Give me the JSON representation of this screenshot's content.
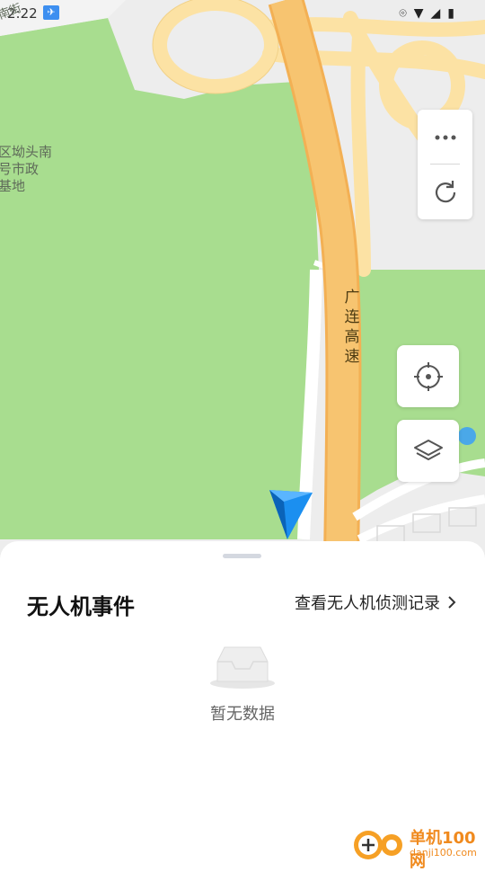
{
  "status_bar": {
    "time": "2:22",
    "icons": [
      "drone-icon",
      "location-icon",
      "wifi-icon",
      "signal-icon",
      "battery-icon"
    ]
  },
  "map": {
    "labels": {
      "top_street": "南街",
      "base_name": "区坳头南\n号市政\n基地",
      "highway": "广\n连\n高\n速"
    },
    "colors": {
      "park": "#a8dd8f",
      "road_major": "#f7c470",
      "road_major_edge": "#f3b054",
      "ramp": "#fce2a4",
      "ground": "#ededed"
    }
  },
  "controls": {
    "more_icon": "more-dots-icon",
    "refresh_icon": "refresh-icon",
    "locate_icon": "locate-target-icon",
    "layers_icon": "layers-icon"
  },
  "sheet": {
    "title": "无人机事件",
    "link_label": "查看无人机侦测记录",
    "empty_text": "暂无数据"
  },
  "watermark": {
    "brand": "单机100网",
    "site": "danji100.com"
  }
}
